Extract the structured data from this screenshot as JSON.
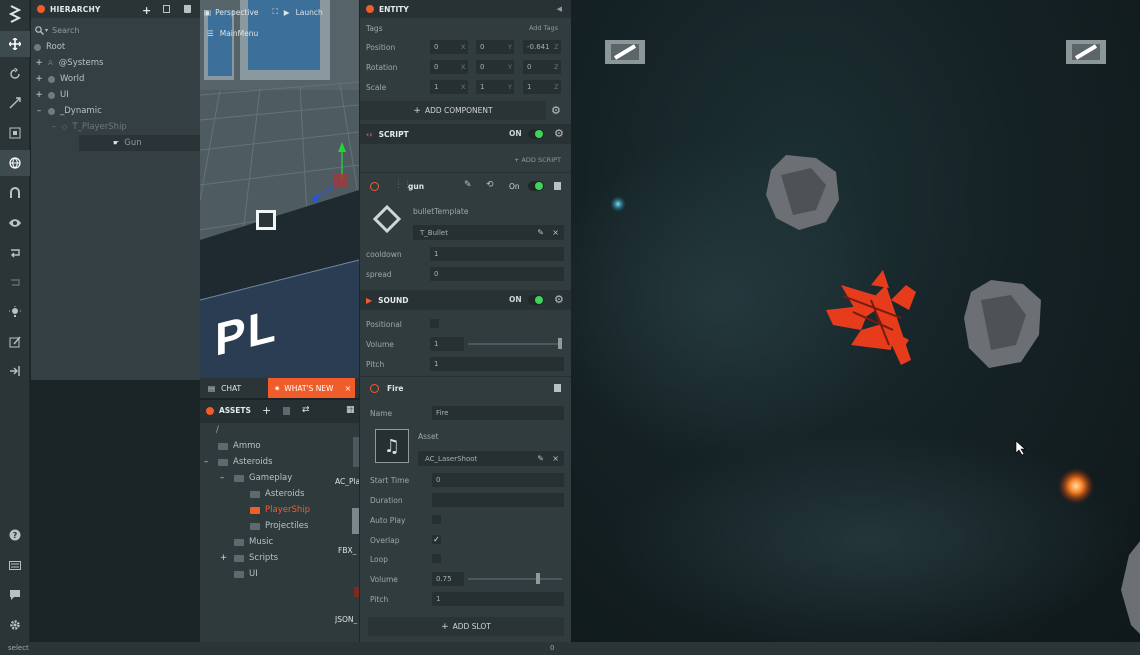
{
  "hierarchy": {
    "title": "HIERARCHY",
    "search_placeholder": "Search",
    "items": [
      {
        "label": "Root"
      },
      {
        "label": "@Systems"
      },
      {
        "label": "World"
      },
      {
        "label": "UI"
      },
      {
        "label": "_Dynamic"
      },
      {
        "label": "T_PlayerShip"
      },
      {
        "label": "Gun"
      }
    ]
  },
  "viewport": {
    "camera_label": "Perspective",
    "launch_label": "Launch",
    "menu_label": "MainMenu",
    "sign_text": "PL"
  },
  "bottom_tabs": {
    "chat": "CHAT",
    "whats_new": "WHAT'S NEW"
  },
  "assets": {
    "title": "ASSETS",
    "root": "/",
    "tree": [
      {
        "label": "Ammo"
      },
      {
        "label": "Asteroids"
      },
      {
        "label": "Gameplay"
      },
      {
        "label": "Asteroids"
      },
      {
        "label": "PlayerShip"
      },
      {
        "label": "Projectiles"
      },
      {
        "label": "Music"
      },
      {
        "label": "Scripts"
      },
      {
        "label": "UI"
      }
    ],
    "files": [
      {
        "label": "AC_Pla"
      },
      {
        "label": "FBX_"
      },
      {
        "label": "JSON_"
      }
    ]
  },
  "entity": {
    "title": "ENTITY",
    "tags_label": "Tags",
    "add_tags": "Add Tags",
    "position": {
      "label": "Position",
      "x": "0",
      "y": "0",
      "z": "-0.641"
    },
    "rotation": {
      "label": "Rotation",
      "x": "0",
      "y": "0",
      "z": "0"
    },
    "scale": {
      "label": "Scale",
      "x": "1",
      "y": "1",
      "z": "1"
    },
    "axis_x": "X",
    "axis_y": "Y",
    "axis_z": "Z",
    "add_component": "ADD COMPONENT"
  },
  "script": {
    "title": "SCRIPT",
    "on": "ON",
    "add_script": "ADD SCRIPT",
    "gun": {
      "name": "gun",
      "on": "On",
      "bullet_template_label": "bulletTemplate",
      "bullet_template_value": "T_Bullet",
      "cooldown_label": "cooldown",
      "cooldown_value": "1",
      "spread_label": "spread",
      "spread_value": "0"
    }
  },
  "sound": {
    "title": "SOUND",
    "on": "ON",
    "positional_label": "Positional",
    "volume_label": "Volume",
    "volume_value": "1",
    "volume_level": 1.0,
    "pitch_label": "Pitch",
    "pitch_value": "1",
    "slot": {
      "name": "Fire",
      "name_label": "Name",
      "name_value": "Fire",
      "asset_label": "Asset",
      "asset_value": "AC_LaserShoot",
      "start_time_label": "Start Time",
      "start_time_value": "0",
      "duration_label": "Duration",
      "duration_value": "",
      "auto_play_label": "Auto Play",
      "overlap_label": "Overlap",
      "overlap_checked": true,
      "loop_label": "Loop",
      "volume_label": "Volume",
      "volume_value": "0.75",
      "volume_level": 0.75,
      "pitch_label": "Pitch",
      "pitch_value": "1"
    },
    "add_slot": "ADD SLOT"
  },
  "status": {
    "text": "select",
    "right": "0"
  },
  "colors": {
    "accent": "#f05d2b",
    "toggle_on": "#3ed45a"
  }
}
